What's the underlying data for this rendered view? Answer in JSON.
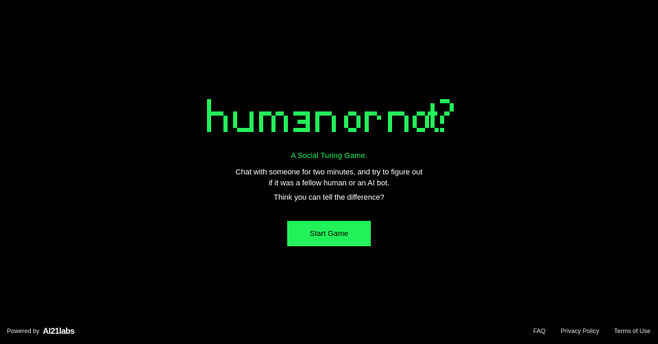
{
  "app": {
    "logo_text": "human or not?",
    "tagline": "A Social Turing Game.",
    "description": "Chat with someone for two minutes, and try to figure out if it was a fellow human or an AI bot.",
    "question": "Think you can tell the difference?",
    "start_button_label": "Start Game"
  },
  "footer": {
    "powered_by": "Powered by",
    "brand": "AI21labs",
    "links": [
      {
        "label": "FAQ"
      },
      {
        "label": "Privacy Policy"
      },
      {
        "label": "Terms of Use"
      }
    ]
  },
  "colors": {
    "background": "#000000",
    "accent": "#22f25a",
    "text": "#ffffff"
  }
}
